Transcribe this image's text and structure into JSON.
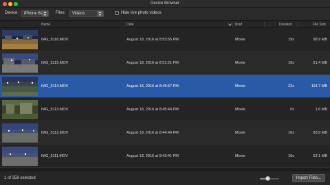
{
  "window": {
    "title": "Device Browser"
  },
  "toolbar": {
    "device_label": "Device:",
    "device_value": "iPhone 6s",
    "files_label": "Files:",
    "files_value": "Videos",
    "hide_live_label": "Hide live photo videos",
    "hide_live_checked": false
  },
  "columns": {
    "name": "Name",
    "date": "Date",
    "kind": "Kind",
    "duration": "Duration",
    "file_size": "File Size"
  },
  "files": [
    {
      "name": "IMG_5116.MOV",
      "date": "August 18, 2016 at 8:53:55 PM",
      "kind": "Movie",
      "duration": "19s",
      "size": "98.9 MB",
      "selected": false
    },
    {
      "name": "IMG_5115.MOV",
      "date": "August 18, 2016 at 8:51:21 PM",
      "kind": "Movie",
      "duration": "10s",
      "size": "51.4 MB",
      "selected": false
    },
    {
      "name": "IMG_5114.MOV",
      "date": "August 18, 2016 at 8:49:57 PM",
      "kind": "Movie",
      "duration": "22s",
      "size": "114.7 MB",
      "selected": true
    },
    {
      "name": "IMG_5113.MOV",
      "date": "August 18, 2016 at 8:45:44 PM",
      "kind": "Movie",
      "duration": "0s",
      "size": "1.6 MB",
      "selected": false
    },
    {
      "name": "IMG_5112.MOV",
      "date": "August 18, 2016 at 8:44:49 PM",
      "kind": "Movie",
      "duration": "16s",
      "size": "83.9 MB",
      "selected": false
    },
    {
      "name": "IMG_5111.MOV",
      "date": "August 18, 2016 at 8:43:41 PM",
      "kind": "Movie",
      "duration": "10s",
      "size": "52.1 MB",
      "selected": false
    }
  ],
  "status": {
    "selection_text": "1 of 358 selected",
    "zoom_level": 0.4,
    "import_label": "Import Files..."
  },
  "colors": {
    "selection": "#2a5aa6",
    "background": "#1e1e1e"
  }
}
